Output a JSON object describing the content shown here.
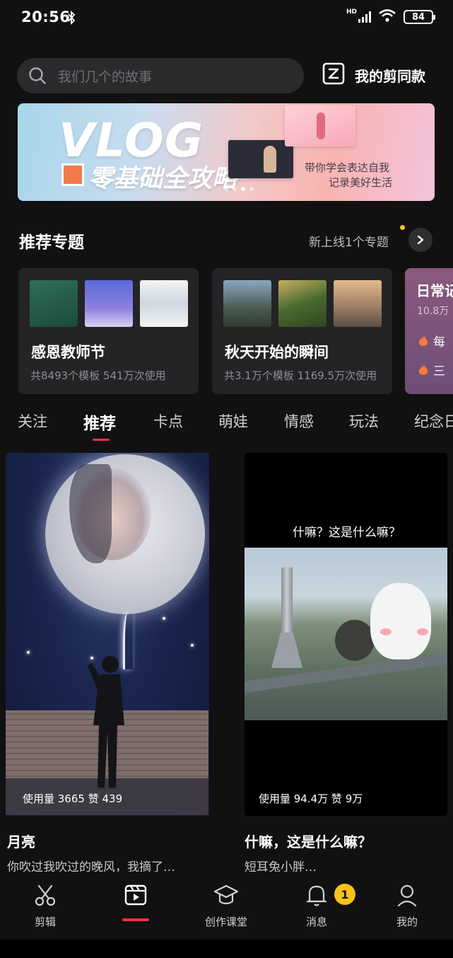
{
  "status_bar": {
    "time": "20:56",
    "network": "HD",
    "battery": "84"
  },
  "header": {
    "search": {
      "placeholder": "我们几个的故事"
    },
    "same_style_label": "我的剪同款"
  },
  "banner": {
    "title_en": "VLOG",
    "title_cn": "零基础全攻略",
    "slogan_line1": "带你学会表达自我",
    "slogan_line2": "记录美好生活",
    "slide_count": 4,
    "active_slide": 3
  },
  "topics": {
    "title": "推荐专题",
    "new_notice": "新上线1个专题",
    "cards": [
      {
        "name": "感恩教师节",
        "stats": "共8493个模板 541万次使用"
      },
      {
        "name": "秋天开始的瞬间",
        "stats": "共3.1万个模板 1169.5万次使用"
      },
      {
        "name": "日常记",
        "stats": "10.8万",
        "hot": [
          "每",
          "三"
        ]
      }
    ]
  },
  "tabs": [
    "关注",
    "推荐",
    "卡点",
    "萌娃",
    "情感",
    "玩法",
    "纪念日"
  ],
  "active_tab": "推荐",
  "feed": [
    {
      "usage": "使用量 3665 赞 439",
      "title": "月亮",
      "desc": "你吹过我吹过的晚风，我摘了…"
    },
    {
      "caption": "什嘛？这是什么嘛？",
      "usage": "使用量 94.4万 赞 9万",
      "title": "什嘛，这是什么嘛？",
      "desc": "短耳兔小胖…"
    }
  ],
  "bottom_nav": {
    "items": [
      "剪辑",
      "",
      "创作课堂",
      "消息",
      "我的"
    ],
    "active_index": 1,
    "message_badge": "1"
  },
  "colors": {
    "accent": "#f0304a",
    "badge": "#f7c21b",
    "background": "#111112",
    "card": "#242426"
  }
}
